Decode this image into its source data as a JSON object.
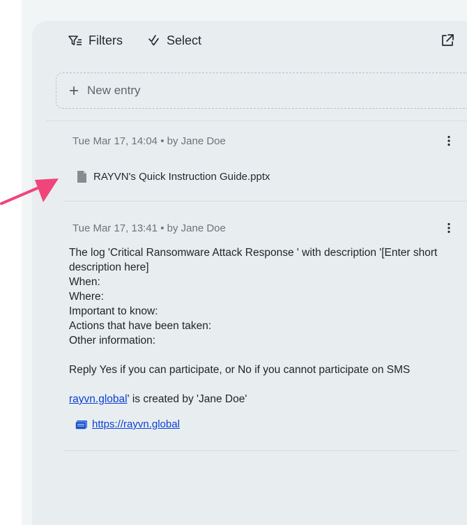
{
  "toolbar": {
    "filters_label": "Filters",
    "select_label": "Select"
  },
  "new_entry": {
    "label": "New entry"
  },
  "entries": [
    {
      "timestamp": "Tue Mar 17, 14:04",
      "separator": "•",
      "author": "by Jane Doe",
      "attachment": "RAYVN's Quick Instruction Guide.pptx"
    },
    {
      "timestamp": "Tue Mar 17, 13:41",
      "separator": "•",
      "author": "by Jane Doe",
      "lines": [
        "The log 'Critical Ransomware Attack Response ' with description '[Enter short description here]",
        "When:",
        "Where:",
        "Important to know:",
        "Actions that have been taken:",
        "Other information:",
        "Reply Yes if you can participate, or No if you cannot participate on SMS"
      ],
      "link_text": "rayvn.global",
      "link_suffix": "' is created by 'Jane Doe'",
      "link_card": "https://rayvn.global"
    }
  ],
  "colors": {
    "accent_arrow": "#f0457a",
    "link": "#0b3fd6",
    "panel_bg": "#e8eef0"
  }
}
